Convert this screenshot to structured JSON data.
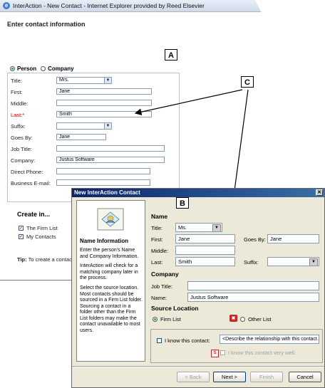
{
  "ie": {
    "title": "InterAction - New Contact - Internet Explorer provided by Reed Elsevier",
    "heading": "Enter contact information",
    "type_person": "Person",
    "type_company": "Company",
    "fields": [
      {
        "label": "Title:",
        "value": "Mrs."
      },
      {
        "label": "First:",
        "value": "Jane"
      },
      {
        "label": "Middle:",
        "value": ""
      },
      {
        "label": "Last:*",
        "value": "Smith"
      },
      {
        "label": "Suffix:",
        "value": ""
      },
      {
        "label": "Goes By:",
        "value": "Jane"
      },
      {
        "label": "Job Title:",
        "value": ""
      },
      {
        "label": "Company:",
        "value": "Justus Software"
      },
      {
        "label": "Direct Phone:",
        "value": ""
      },
      {
        "label": "Business E-mail:",
        "value": ""
      }
    ],
    "create_in": "Create in...",
    "firm_list": "The Firm List",
    "my_contacts": "My Contacts",
    "tip": "Tip:",
    "tip_text": "To create a contact"
  },
  "callouts": {
    "a": "A",
    "b": "B",
    "c": "C"
  },
  "dialog": {
    "title": "New InterAction Contact",
    "close": "✕",
    "side": {
      "heading": "Name Information",
      "p1": "Enter the person's Name and Company Information.",
      "p2": "InterAction will check for a matching company later in the process.",
      "p3": "Select the source location. Most contacts should be sourced in a Firm List folder. Sourcing a contact in a folder other than the Firm List folders may make the contact unavailable to most users."
    },
    "name_section": "Name",
    "title_label": "Title:",
    "title_value": "Ms.",
    "first_label": "First:",
    "first_value": "Jane",
    "goes_by_label": "Goes By:",
    "goes_by_value": "Jane",
    "middle_label": "Middle:",
    "middle_value": "",
    "last_label": "Last:",
    "last_value": "Smith",
    "suffix_label": "Suffix:",
    "suffix_value": "",
    "company_section": "Company",
    "job_title_label": "Job Title:",
    "job_title_value": "",
    "company_name_label": "Name:",
    "company_name_value": "Justus Software",
    "source_section": "Source Location",
    "firm_list": "Firm List",
    "other_list": "Other List",
    "know_label": "I know this contact:",
    "know_value": "<Describe the relationship with this contact.>",
    "know_well": "I know this contact very well.",
    "back_btn": "< Back",
    "next_btn": "Next >",
    "finish_btn": "Finish",
    "cancel_btn": "Cancel"
  }
}
